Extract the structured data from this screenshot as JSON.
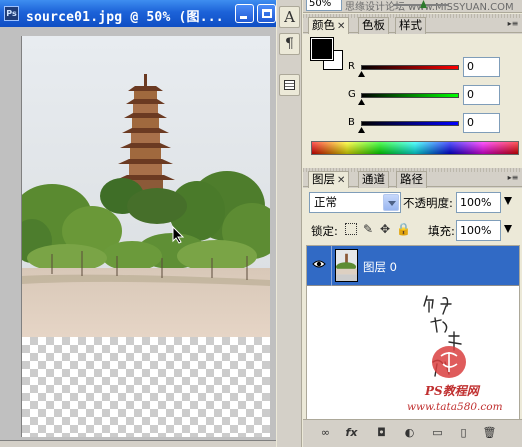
{
  "document": {
    "title": "source01.jpg @ 50% (图...",
    "app_badge": "Ps"
  },
  "dock": {
    "character_glyph": "A",
    "paragraph_glyph": "¶"
  },
  "navigator": {
    "zoom": "50%",
    "watermark": "思缘设计论坛 www.MISSYUAN.COM"
  },
  "color_panel": {
    "tabs": [
      {
        "label": "颜色",
        "active": true,
        "closable": true
      },
      {
        "label": "色板",
        "active": false,
        "closable": false
      },
      {
        "label": "样式",
        "active": false,
        "closable": false
      }
    ],
    "foreground": "#000000",
    "background": "#ffffff",
    "channels": [
      {
        "label": "R",
        "value": "0"
      },
      {
        "label": "G",
        "value": "0"
      },
      {
        "label": "B",
        "value": "0"
      }
    ]
  },
  "layers_panel": {
    "tabs": [
      {
        "label": "图层",
        "active": true,
        "closable": true
      },
      {
        "label": "通道",
        "active": false,
        "closable": false
      },
      {
        "label": "路径",
        "active": false,
        "closable": false
      }
    ],
    "blend_mode": "正常",
    "opacity_label": "不透明度:",
    "opacity_value": "100%",
    "lock_label": "锁定:",
    "fill_label": "填充:",
    "fill_value": "100%",
    "layers": [
      {
        "name": "图层 0",
        "visible": true,
        "selected": true
      }
    ],
    "watermark": {
      "calligraphy": "他她我帮你",
      "brand": "PS教程网",
      "url": "www.tata580.com"
    },
    "footer_glyphs": [
      "∞",
      "fx",
      "◘",
      "◐",
      "▭",
      "▯",
      "🗑"
    ]
  },
  "colors": {
    "titlebar": "#1c62d8",
    "selection": "#316ac5",
    "panel_bg": "#ece9d8"
  }
}
